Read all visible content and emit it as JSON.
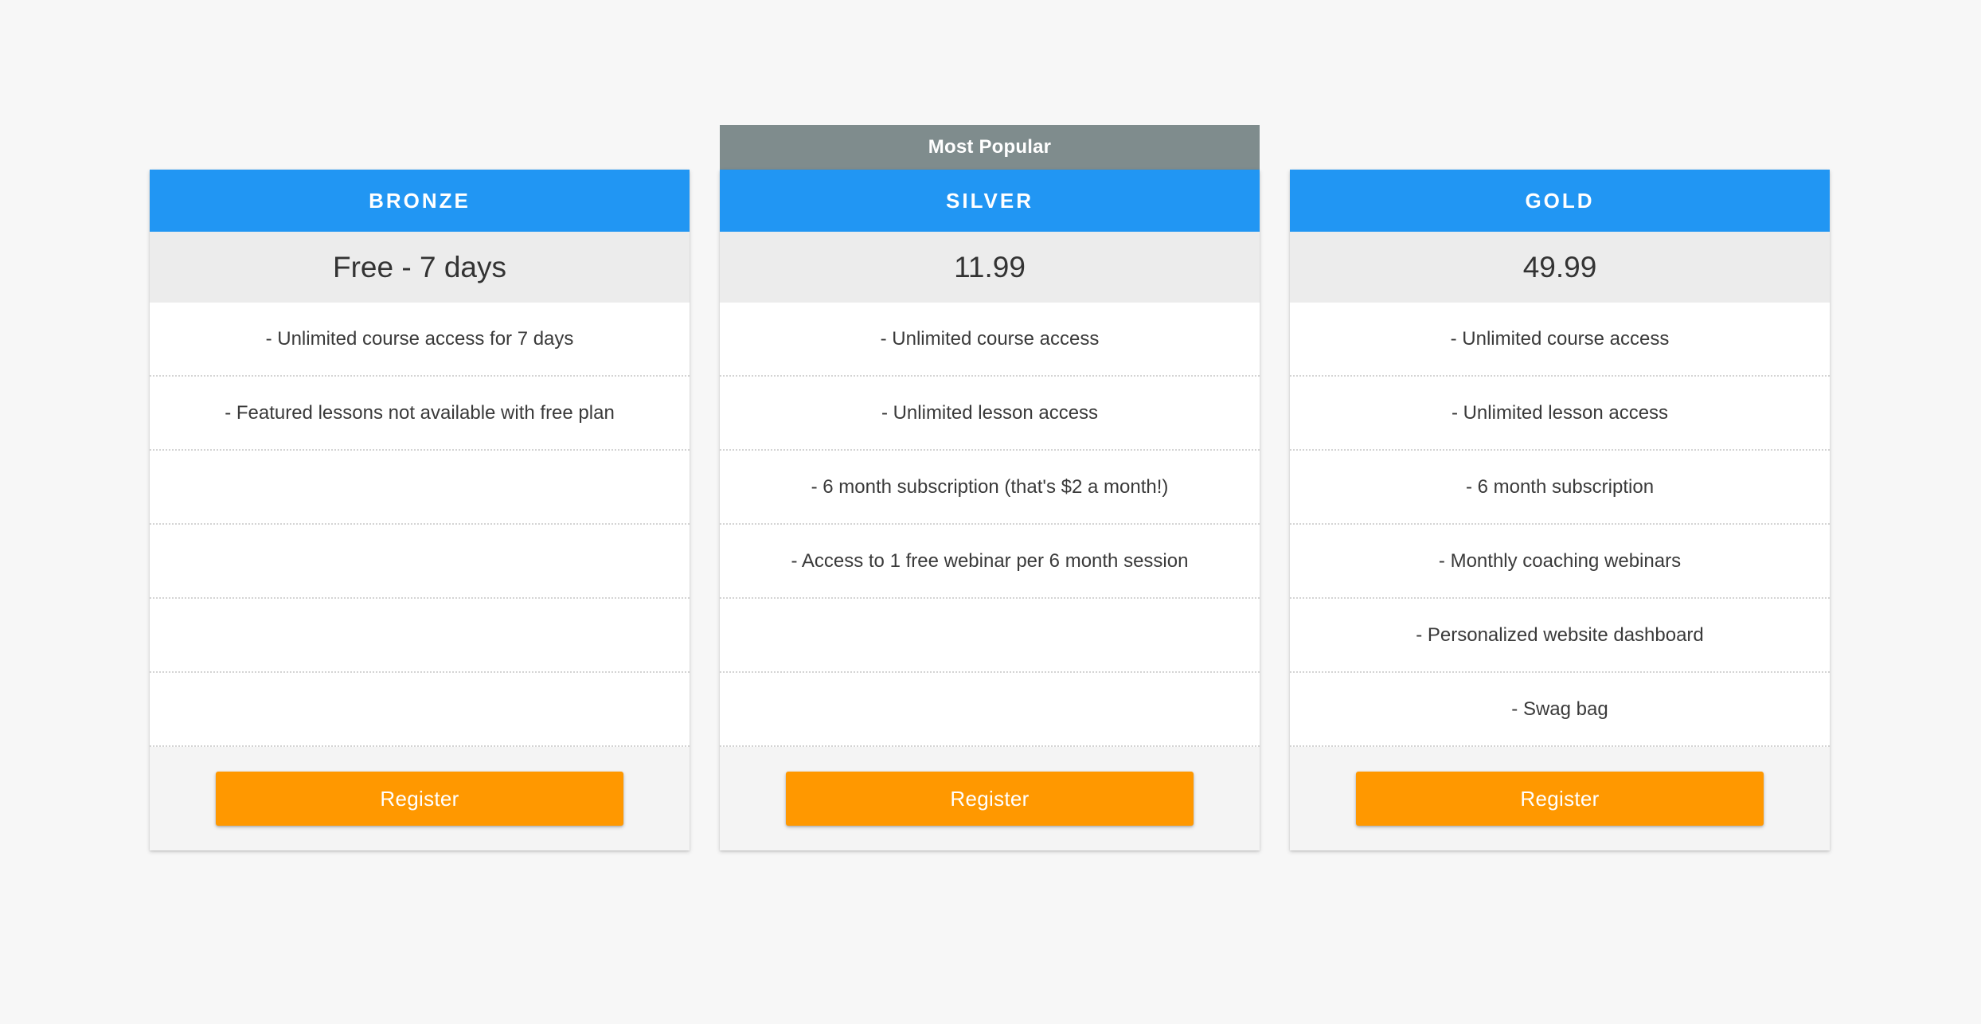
{
  "page": {
    "background_color": "#f7f7f7"
  },
  "theme": {
    "header_blue": "#2196f3",
    "banner_gray": "#7f8c8d",
    "price_band_gray": "#ececec",
    "footer_gray": "#f4f4f4",
    "button_orange": "#ff9800",
    "feature_text": "#3a3a3a"
  },
  "plans": [
    {
      "name": "BRONZE",
      "price": "Free - 7 days",
      "badge": null,
      "features": [
        "- Unlimited course access for 7 days",
        "- Featured lessons not available with free plan",
        "",
        "",
        "",
        ""
      ],
      "cta_label": "Register"
    },
    {
      "name": "SILVER",
      "price": "11.99",
      "badge": "Most Popular",
      "features": [
        "- Unlimited course access",
        "- Unlimited lesson access",
        "- 6 month subscription (that's $2 a month!)",
        "- Access to 1 free webinar per 6 month session",
        "",
        ""
      ],
      "cta_label": "Register"
    },
    {
      "name": "GOLD",
      "price": "49.99",
      "badge": null,
      "features": [
        "- Unlimited course access",
        "- Unlimited lesson access",
        "- 6 month subscription",
        "- Monthly coaching webinars",
        "- Personalized website dashboard",
        "- Swag bag"
      ],
      "cta_label": "Register"
    }
  ]
}
